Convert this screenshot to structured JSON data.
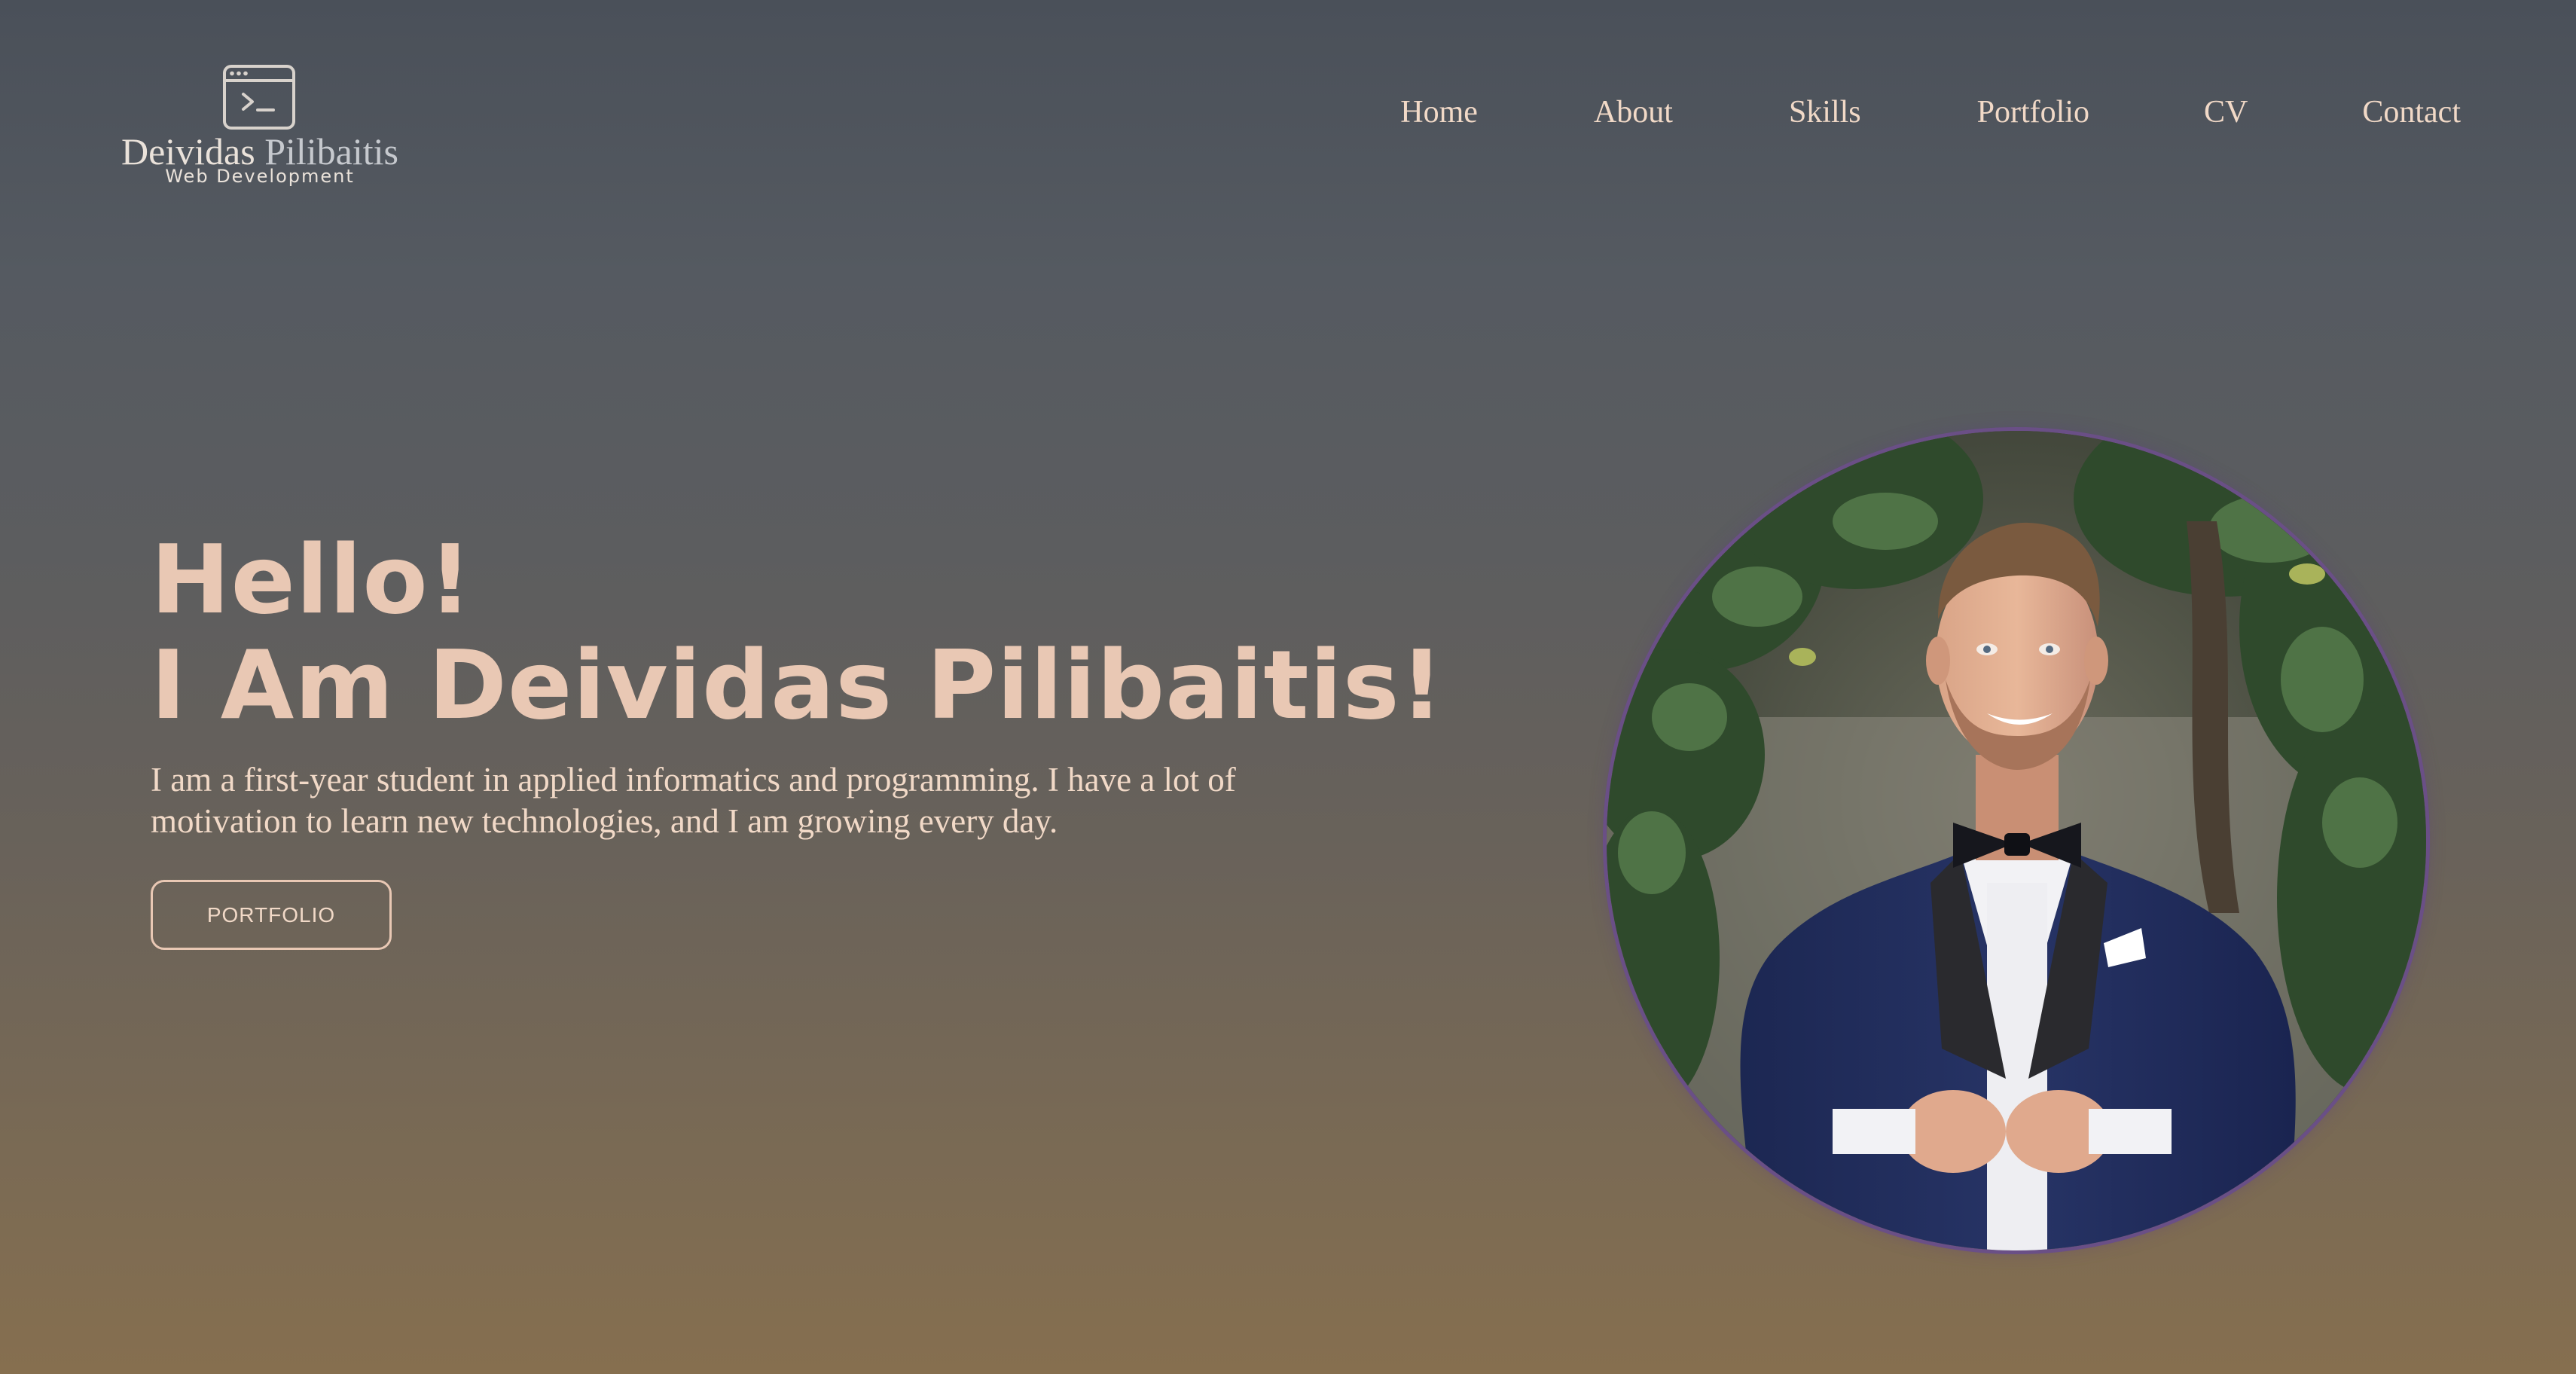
{
  "brand": {
    "icon": "terminal-window-icon",
    "first_name": "Deividas",
    "last_name": "Pilibaitis",
    "tagline": "Web Development"
  },
  "nav": {
    "items": [
      {
        "label": "Home"
      },
      {
        "label": "About"
      },
      {
        "label": "Skills"
      },
      {
        "label": "Portfolio"
      },
      {
        "label": "CV"
      },
      {
        "label": "Contact"
      }
    ]
  },
  "hero": {
    "greeting": "Hello!",
    "headline": "I Am Deividas Pilibaitis!",
    "description": "I am a first-year student in applied informatics and programming. I have a lot of motivation to learn new technologies, and I am growing every day.",
    "cta_label": "PORTFOLIO"
  },
  "portrait": {
    "subject": "portrait-photo"
  },
  "colors": {
    "accent": "#e9c8b4",
    "nav_text": "#f1d9c7",
    "ring": "#6a4f86"
  }
}
